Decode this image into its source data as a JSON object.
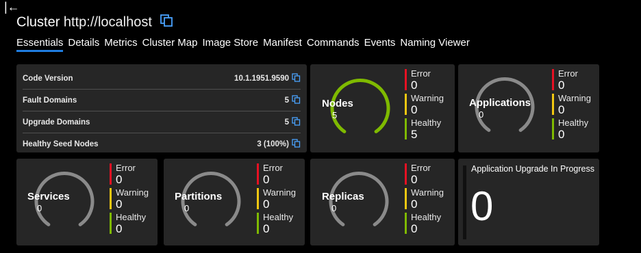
{
  "header": {
    "collapse_glyph": "|←",
    "title": "Cluster",
    "url": "http://localhost"
  },
  "tabs": [
    {
      "label": "Essentials"
    },
    {
      "label": "Details"
    },
    {
      "label": "Metrics"
    },
    {
      "label": "Cluster Map"
    },
    {
      "label": "Image Store"
    },
    {
      "label": "Manifest"
    },
    {
      "label": "Commands"
    },
    {
      "label": "Events"
    },
    {
      "label": "Naming Viewer"
    }
  ],
  "essentials": [
    {
      "label": "Code Version",
      "value": "10.1.1951.9590"
    },
    {
      "label": "Fault Domains",
      "value": "5"
    },
    {
      "label": "Upgrade Domains",
      "value": "5"
    },
    {
      "label": "Healthy Seed Nodes",
      "value": "3 (100%)"
    }
  ],
  "status_labels": {
    "error": "Error",
    "warning": "Warning",
    "healthy": "Healthy"
  },
  "status_colors": {
    "error": "#e81123",
    "warning": "#f2c811",
    "healthy": "#7fba00",
    "ring_gray": "#8a8a8a",
    "accent": "#1f7de0"
  },
  "nodes": {
    "title": "Nodes",
    "count": "5",
    "error": "0",
    "warning": "0",
    "healthy": "5"
  },
  "applications": {
    "title": "Applications",
    "count": "0",
    "error": "0",
    "warning": "0",
    "healthy": "0"
  },
  "services": {
    "title": "Services",
    "count": "0",
    "error": "0",
    "warning": "0",
    "healthy": "0"
  },
  "partitions": {
    "title": "Partitions",
    "count": "0",
    "error": "0",
    "warning": "0",
    "healthy": "0"
  },
  "replicas": {
    "title": "Replicas",
    "count": "0",
    "error": "0",
    "warning": "0",
    "healthy": "0"
  },
  "upgrade": {
    "title": "Application Upgrade In Progress",
    "value": "0"
  }
}
